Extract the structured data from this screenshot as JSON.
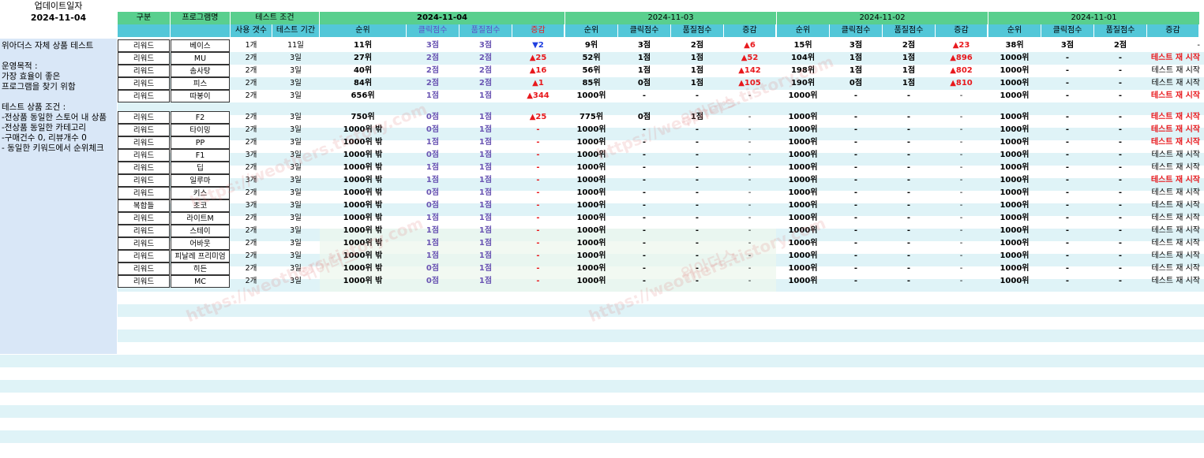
{
  "top": {
    "update_label": "업데이트일자",
    "update_date": "2024-11-04"
  },
  "header": {
    "category": "구분",
    "program": "프로그램명",
    "test_conditions": "테스트 조건",
    "use_count": "사용 갯수",
    "test_period": "테스트 기간",
    "dates": [
      "2024-11-04",
      "2024-11-03",
      "2024-11-02",
      "2024-11-01"
    ],
    "subcols": [
      "순위",
      "클릭점수",
      "품질점수",
      "증감"
    ]
  },
  "info": {
    "lines": "위아더스 자체 상품 테스트\n\n운영목적 :\n가장 효율이 좋은\n프로그램을 찾기 위함\n\n테스트 상품 조건 :\n-전상품 동일한 스토어 내 상품\n-전상품 동일한 카테고리\n-구매건수 0, 리뷰개수 0\n- 동일한 키워드에서 순위체크"
  },
  "watermark": "https://weothers.tistory.com",
  "watermark_kr": "위아더스",
  "rows": [
    {
      "cat": "리워드",
      "prog": "베이스",
      "cnt": "1개",
      "period": "11일",
      "d1": [
        "11위",
        "3점",
        "3점",
        "▼2"
      ],
      "d1c": "blue",
      "d2": [
        "9위",
        "3점",
        "2점",
        "▲6"
      ],
      "d3": [
        "15위",
        "3점",
        "2점",
        "▲23"
      ],
      "d4": [
        "38위",
        "3점",
        "2점",
        "-"
      ],
      "d4c": "black"
    },
    {
      "cat": "리워드",
      "prog": "MU",
      "cnt": "2개",
      "period": "3일",
      "d1": [
        "27위",
        "2점",
        "2점",
        "▲25"
      ],
      "d1c": "red",
      "d2": [
        "52위",
        "1점",
        "1점",
        "▲52"
      ],
      "d3": [
        "104위",
        "1점",
        "1점",
        "▲896"
      ],
      "d4": [
        "1000위",
        "-",
        "-",
        "테스트 재 시작"
      ],
      "d4c": "red"
    },
    {
      "cat": "리워드",
      "prog": "솜사탕",
      "cnt": "2개",
      "period": "3일",
      "d1": [
        "40위",
        "2점",
        "2점",
        "▲16"
      ],
      "d1c": "red",
      "d2": [
        "56위",
        "1점",
        "1점",
        "▲142"
      ],
      "d3": [
        "198위",
        "1점",
        "1점",
        "▲802"
      ],
      "d4": [
        "1000위",
        "-",
        "-",
        "테스트 재 시작"
      ],
      "d4c": "black"
    },
    {
      "cat": "리워드",
      "prog": "피스",
      "cnt": "2개",
      "period": "3일",
      "d1": [
        "84위",
        "2점",
        "2점",
        "▲1"
      ],
      "d1c": "red",
      "d2": [
        "85위",
        "0점",
        "1점",
        "▲105"
      ],
      "d3": [
        "190위",
        "0점",
        "1점",
        "▲810"
      ],
      "d4": [
        "1000위",
        "-",
        "-",
        "테스트 재 시작"
      ],
      "d4c": "black"
    },
    {
      "cat": "리워드",
      "prog": "따봉이",
      "cnt": "2개",
      "period": "3일",
      "d1": [
        "656위",
        "1점",
        "1점",
        "▲344"
      ],
      "d1c": "red",
      "d2": [
        "1000위",
        "-",
        "-",
        "-"
      ],
      "d3": [
        "1000위",
        "-",
        "-",
        "-"
      ],
      "d4": [
        "1000위",
        "-",
        "-",
        "테스트 재 시작"
      ],
      "d4c": "red"
    },
    {
      "cat": "리워드",
      "prog": "F2",
      "cnt": "2개",
      "period": "3일",
      "d1": [
        "750위",
        "0점",
        "1점",
        "▲25"
      ],
      "d1c": "red",
      "d2": [
        "775위",
        "0점",
        "1점",
        "-"
      ],
      "d3": [
        "1000위",
        "-",
        "-",
        "-"
      ],
      "d4": [
        "1000위",
        "-",
        "-",
        "테스트 재 시작"
      ],
      "d4c": "red"
    },
    {
      "cat": "리워드",
      "prog": "타이밍",
      "cnt": "2개",
      "period": "3일",
      "d1": [
        "1000위 밖",
        "0점",
        "1점",
        "-"
      ],
      "d1c": "red",
      "d2": [
        "1000위",
        "-",
        "-",
        "-"
      ],
      "d3": [
        "1000위",
        "-",
        "-",
        "-"
      ],
      "d4": [
        "1000위",
        "-",
        "-",
        "테스트 재 시작"
      ],
      "d4c": "red"
    },
    {
      "cat": "리워드",
      "prog": "PP",
      "cnt": "2개",
      "period": "3일",
      "d1": [
        "1000위 밖",
        "1점",
        "1점",
        "-"
      ],
      "d1c": "red",
      "d2": [
        "1000위",
        "-",
        "-",
        "-"
      ],
      "d3": [
        "1000위",
        "-",
        "-",
        "-"
      ],
      "d4": [
        "1000위",
        "-",
        "-",
        "테스트 재 시작"
      ],
      "d4c": "red"
    },
    {
      "cat": "리워드",
      "prog": "F1",
      "cnt": "3개",
      "period": "3일",
      "d1": [
        "1000위 밖",
        "0점",
        "1점",
        "-"
      ],
      "d1c": "red",
      "d2": [
        "1000위",
        "-",
        "-",
        "-"
      ],
      "d3": [
        "1000위",
        "-",
        "-",
        "-"
      ],
      "d4": [
        "1000위",
        "-",
        "-",
        "테스트 재 시작"
      ],
      "d4c": "black"
    },
    {
      "cat": "리워드",
      "prog": "딥",
      "cnt": "2개",
      "period": "3일",
      "d1": [
        "1000위 밖",
        "1점",
        "1점",
        "-"
      ],
      "d1c": "red",
      "d2": [
        "1000위",
        "-",
        "-",
        "-"
      ],
      "d3": [
        "1000위",
        "-",
        "-",
        "-"
      ],
      "d4": [
        "1000위",
        "-",
        "-",
        "테스트 재 시작"
      ],
      "d4c": "black"
    },
    {
      "cat": "리워드",
      "prog": "일루마",
      "cnt": "3개",
      "period": "3일",
      "d1": [
        "1000위 밖",
        "1점",
        "1점",
        "-"
      ],
      "d1c": "red",
      "d2": [
        "1000위",
        "-",
        "-",
        "-"
      ],
      "d3": [
        "1000위",
        "-",
        "-",
        "-"
      ],
      "d4": [
        "1000위",
        "-",
        "-",
        "테스트 재 시작"
      ],
      "d4c": "red"
    },
    {
      "cat": "리워드",
      "prog": "키스",
      "cnt": "2개",
      "period": "3일",
      "d1": [
        "1000위 밖",
        "0점",
        "1점",
        "-"
      ],
      "d1c": "red",
      "d2": [
        "1000위",
        "-",
        "-",
        "-"
      ],
      "d3": [
        "1000위",
        "-",
        "-",
        "-"
      ],
      "d4": [
        "1000위",
        "-",
        "-",
        "테스트 재 시작"
      ],
      "d4c": "black"
    },
    {
      "cat": "복합들",
      "prog": "초코",
      "cnt": "3개",
      "period": "3일",
      "d1": [
        "1000위 밖",
        "0점",
        "1점",
        "-"
      ],
      "d1c": "red",
      "d2": [
        "1000위",
        "-",
        "-",
        "-"
      ],
      "d3": [
        "1000위",
        "-",
        "-",
        "-"
      ],
      "d4": [
        "1000위",
        "-",
        "-",
        "테스트 재 시작"
      ],
      "d4c": "black"
    },
    {
      "cat": "리워드",
      "prog": "라이트M",
      "cnt": "2개",
      "period": "3일",
      "d1": [
        "1000위 밖",
        "1점",
        "1점",
        "-"
      ],
      "d1c": "red",
      "d2": [
        "1000위",
        "-",
        "-",
        "-"
      ],
      "d3": [
        "1000위",
        "-",
        "-",
        "-"
      ],
      "d4": [
        "1000위",
        "-",
        "-",
        "테스트 재 시작"
      ],
      "d4c": "black"
    },
    {
      "cat": "리워드",
      "prog": "스테이",
      "cnt": "2개",
      "period": "3일",
      "d1": [
        "1000위 밖",
        "1점",
        "1점",
        "-"
      ],
      "d1c": "red",
      "d2": [
        "1000위",
        "-",
        "-",
        "-"
      ],
      "d3": [
        "1000위",
        "-",
        "-",
        "-"
      ],
      "d4": [
        "1000위",
        "-",
        "-",
        "테스트 재 시작"
      ],
      "d4c": "black"
    },
    {
      "cat": "리워드",
      "prog": "어바웃",
      "cnt": "2개",
      "period": "3일",
      "d1": [
        "1000위 밖",
        "1점",
        "1점",
        "-"
      ],
      "d1c": "red",
      "d2": [
        "1000위",
        "-",
        "-",
        "-"
      ],
      "d3": [
        "1000위",
        "-",
        "-",
        "-"
      ],
      "d4": [
        "1000위",
        "-",
        "-",
        "테스트 재 시작"
      ],
      "d4c": "black"
    },
    {
      "cat": "리워드",
      "prog": "피날레 프리미엄",
      "cnt": "2개",
      "period": "3일",
      "d1": [
        "1000위 밖",
        "1점",
        "1점",
        "-"
      ],
      "d1c": "red",
      "d2": [
        "1000위",
        "-",
        "-",
        "-"
      ],
      "d3": [
        "1000위",
        "-",
        "-",
        "-"
      ],
      "d4": [
        "1000위",
        "-",
        "-",
        "테스트 재 시작"
      ],
      "d4c": "black"
    },
    {
      "cat": "리워드",
      "prog": "히든",
      "cnt": "2개",
      "period": "3일",
      "d1": [
        "1000위 밖",
        "0점",
        "1점",
        "-"
      ],
      "d1c": "red",
      "d2": [
        "1000위",
        "-",
        "-",
        "-"
      ],
      "d3": [
        "1000위",
        "-",
        "-",
        "-"
      ],
      "d4": [
        "1000위",
        "-",
        "-",
        "테스트 재 시작"
      ],
      "d4c": "black"
    },
    {
      "cat": "리워드",
      "prog": "MC",
      "cnt": "2개",
      "period": "3일",
      "d1": [
        "1000위 밖",
        "0점",
        "1점",
        "-"
      ],
      "d1c": "red",
      "d2": [
        "1000위",
        "-",
        "-",
        "-"
      ],
      "d3": [
        "1000위",
        "-",
        "-",
        "-"
      ],
      "d4": [
        "1000위",
        "-",
        "-",
        "테스트 재 시작"
      ],
      "d4c": "black"
    }
  ]
}
